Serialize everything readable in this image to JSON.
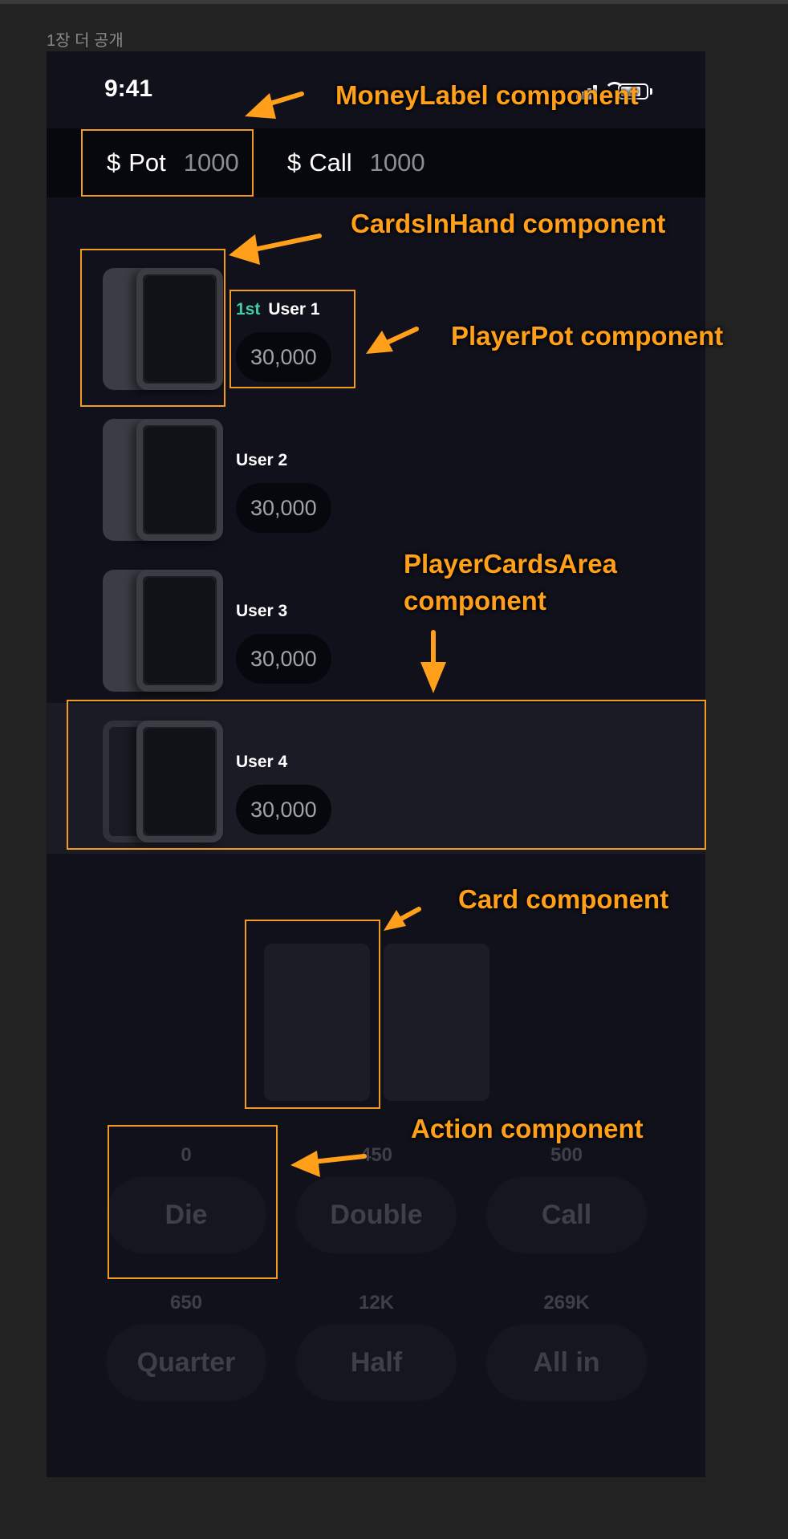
{
  "frame_title": "1장 더 공개",
  "status_bar": {
    "time": "9:41",
    "icons": [
      "signal-icon",
      "wifi-icon",
      "battery-icon"
    ]
  },
  "money_labels": {
    "pot": {
      "symbol": "$",
      "name": "Pot",
      "amount": "1000"
    },
    "call": {
      "symbol": "$",
      "name": "Call",
      "amount": "1000"
    }
  },
  "players": [
    {
      "rank": "1st",
      "name": "User 1",
      "chips": "30,000",
      "active": false
    },
    {
      "rank": "",
      "name": "User 2",
      "chips": "30,000",
      "active": false
    },
    {
      "rank": "",
      "name": "User 3",
      "chips": "30,000",
      "active": false
    },
    {
      "rank": "",
      "name": "User 4",
      "chips": "30,000",
      "active": true
    }
  ],
  "actions": [
    {
      "amount": "0",
      "label": "Die"
    },
    {
      "amount": "450",
      "label": "Double"
    },
    {
      "amount": "500",
      "label": "Call"
    },
    {
      "amount": "650",
      "label": "Quarter"
    },
    {
      "amount": "12K",
      "label": "Half"
    },
    {
      "amount": "269K",
      "label": "All in"
    }
  ],
  "annotations": {
    "money_label": "MoneyLabel component",
    "cards_in_hand": "CardsInHand component",
    "player_pot": "PlayerPot component",
    "player_cards_area_line1": "PlayerCardsArea",
    "player_cards_area_line2": "component",
    "card": "Card component",
    "action": "Action component"
  },
  "colors": {
    "annotation": "#f39a22",
    "background": "#10111a",
    "rank_accent": "#3ccfa5"
  }
}
